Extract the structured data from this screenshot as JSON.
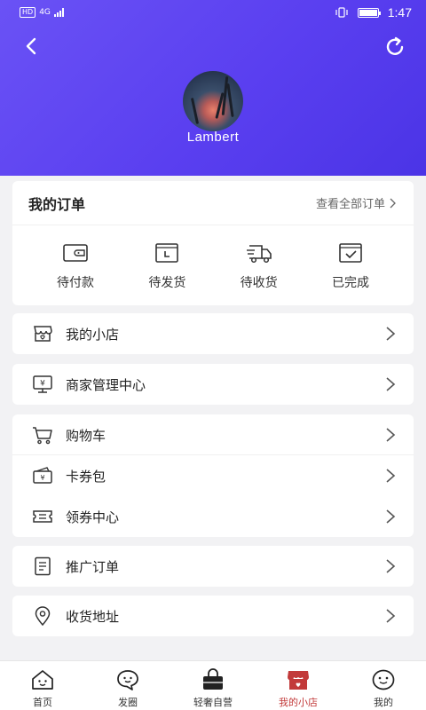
{
  "status_bar": {
    "left_badge": "HD",
    "network": "4G",
    "time": "1:47"
  },
  "profile": {
    "username": "Lambert"
  },
  "orders": {
    "title": "我的订单",
    "view_all": "查看全部订单",
    "items": [
      {
        "label": "待付款",
        "icon": "wallet-icon"
      },
      {
        "label": "待发货",
        "icon": "clock-box-icon"
      },
      {
        "label": "待收货",
        "icon": "truck-icon"
      },
      {
        "label": "已完成",
        "icon": "check-box-icon"
      }
    ]
  },
  "menu_groups": [
    [
      {
        "label": "我的小店",
        "icon": "shop-icon"
      }
    ],
    [
      {
        "label": "商家管理中心",
        "icon": "monitor-yen-icon"
      }
    ],
    [
      {
        "label": "购物车",
        "icon": "cart-icon"
      },
      {
        "label": "卡券包",
        "icon": "card-wallet-icon"
      },
      {
        "label": "领券中心",
        "icon": "coupon-icon"
      }
    ],
    [
      {
        "label": "推广订单",
        "icon": "document-icon"
      }
    ],
    [
      {
        "label": "收货地址",
        "icon": "location-pin-icon"
      }
    ]
  ],
  "tabbar": [
    {
      "label": "首页",
      "icon": "home-icon",
      "active": false
    },
    {
      "label": "发圈",
      "icon": "chat-bubble-icon",
      "active": false
    },
    {
      "label": "轻奢自营",
      "icon": "bag-icon",
      "active": false
    },
    {
      "label": "我的小店",
      "icon": "store-icon",
      "active": true
    },
    {
      "label": "我的",
      "icon": "smiley-icon",
      "active": false
    }
  ],
  "colors": {
    "header_start": "#6a52f5",
    "header_end": "#4b34e6",
    "active_tab": "#c23a3a",
    "background": "#f2f2f4"
  }
}
